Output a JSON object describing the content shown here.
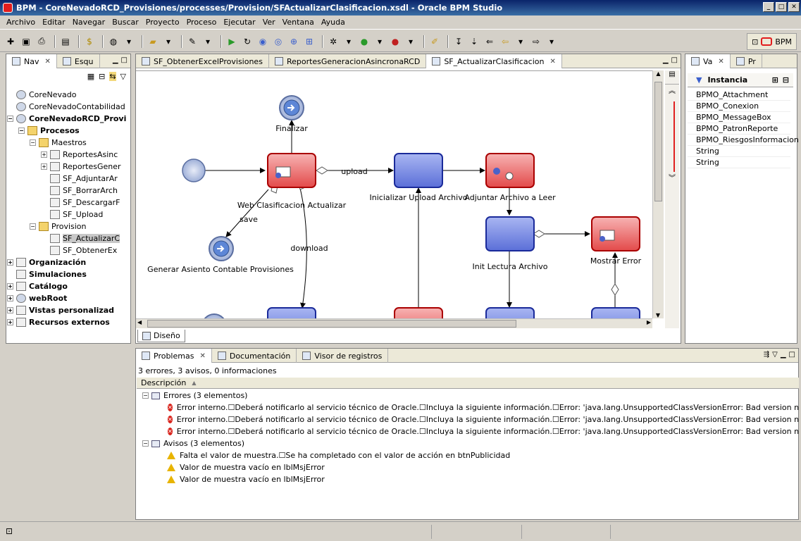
{
  "window": {
    "title": "BPM - CoreNevadoRCD_Provisiones/processes/Provision/SFActualizarClasificacion.xsdl - Oracle BPM Studio"
  },
  "menu": [
    "Archivo",
    "Editar",
    "Navegar",
    "Buscar",
    "Proyecto",
    "Proceso",
    "Ejecutar",
    "Ver",
    "Ventana",
    "Ayuda"
  ],
  "perspective": {
    "label": "BPM"
  },
  "nav": {
    "tabs": [
      {
        "label": "Nav"
      },
      {
        "label": "Esqu"
      }
    ],
    "tree": [
      {
        "label": "CoreNevado",
        "level": 0,
        "icon": "globe"
      },
      {
        "label": "CoreNevadoContabilidad",
        "level": 0,
        "icon": "globe"
      },
      {
        "label": "CoreNevadoRCD_Provi",
        "level": 0,
        "icon": "globe",
        "bold": true,
        "exp": "-"
      },
      {
        "label": "Procesos",
        "level": 1,
        "icon": "folder",
        "bold": true,
        "exp": "-"
      },
      {
        "label": "Maestros",
        "level": 2,
        "icon": "folder",
        "exp": "-"
      },
      {
        "label": "ReportesAsinc",
        "level": 3,
        "icon": "proc",
        "exp": "+"
      },
      {
        "label": "ReportesGener",
        "level": 3,
        "icon": "proc",
        "exp": "+"
      },
      {
        "label": "SF_AdjuntarAr",
        "level": 3,
        "icon": "proc"
      },
      {
        "label": "SF_BorrarArch",
        "level": 3,
        "icon": "proc"
      },
      {
        "label": "SF_DescargarF",
        "level": 3,
        "icon": "proc"
      },
      {
        "label": "SF_Upload",
        "level": 3,
        "icon": "proc"
      },
      {
        "label": "Provision",
        "level": 2,
        "icon": "folder",
        "exp": "-"
      },
      {
        "label": "SF_ActualizarC",
        "level": 3,
        "icon": "proc",
        "selected": true
      },
      {
        "label": "SF_ObtenerEx",
        "level": 3,
        "icon": "proc"
      },
      {
        "label": "Organización",
        "level": 0,
        "icon": "org",
        "bold": true,
        "exp": "+"
      },
      {
        "label": "Simulaciones",
        "level": 0,
        "icon": "sim",
        "bold": true
      },
      {
        "label": "Catálogo",
        "level": 0,
        "icon": "cat",
        "bold": true,
        "exp": "+"
      },
      {
        "label": "webRoot",
        "level": 0,
        "icon": "globe",
        "bold": true,
        "exp": "+"
      },
      {
        "label": "Vistas personalizad",
        "level": 0,
        "icon": "grid",
        "bold": true,
        "exp": "+"
      },
      {
        "label": "Recursos externos",
        "level": 0,
        "icon": "res",
        "bold": true,
        "exp": "+"
      }
    ]
  },
  "editor": {
    "tabs": [
      {
        "label": "SF_ObtenerExcelProvisiones",
        "active": false
      },
      {
        "label": "ReportesGeneracionAsincronaRCD",
        "active": false
      },
      {
        "label": "SF_ActualizarClasificacion",
        "active": true
      }
    ],
    "bottom_tab": "Diseño",
    "diagram": {
      "labels": {
        "finalizar": "Finalizar",
        "web": "Web Clasificacion Actualizar",
        "upload": "upload",
        "inicializar": "Inicializar Upload Archivo",
        "adjuntar": "Adjuntar Archivo a Leer",
        "init_lectura": "Init Lectura Archivo",
        "mostrar_error": "Mostrar Error",
        "save": "save",
        "download": "download",
        "generar": "Generar Asiento Contable Provisiones"
      }
    }
  },
  "variables": {
    "tabs": [
      {
        "label": "Va"
      },
      {
        "label": "Pr"
      }
    ],
    "header": "Instancia",
    "items": [
      "BPMO_Attachment",
      "BPMO_Conexion",
      "BPMO_MessageBox",
      "BPMO_PatronReporte",
      "BPMO_RiesgosInformacion",
      "String",
      "String"
    ]
  },
  "problems": {
    "tabs": [
      {
        "label": "Problemas"
      },
      {
        "label": "Documentación"
      },
      {
        "label": "Visor de registros"
      }
    ],
    "summary": "3 errores, 3 avisos, 0 informaciones",
    "column": "Descripción",
    "errors_group": "Errores (3 elementos)",
    "errors": [
      "Error interno.☐Deberá notificarlo al servicio técnico de Oracle.☐Incluya la siguiente información.☐Error: 'java.lang.UnsupportedClassVersionError: Bad version number in .class file'.",
      "Error interno.☐Deberá notificarlo al servicio técnico de Oracle.☐Incluya la siguiente información.☐Error: 'java.lang.UnsupportedClassVersionError: Bad version number in .class file'.",
      "Error interno.☐Deberá notificarlo al servicio técnico de Oracle.☐Incluya la siguiente información.☐Error: 'java.lang.UnsupportedClassVersionError: Bad version number in .class file'."
    ],
    "warnings_group": "Avisos (3 elementos)",
    "warnings": [
      "Falta el valor de muestra.☐Se ha completado con el valor de acción en btnPublicidad",
      "Valor de muestra vacío en lblMsjError",
      "Valor de muestra vacío en lblMsjError"
    ]
  },
  "colors": {
    "task_red": "#e34a4a",
    "task_blue": "#5b6fd8",
    "title_bar": "#0a246a"
  }
}
